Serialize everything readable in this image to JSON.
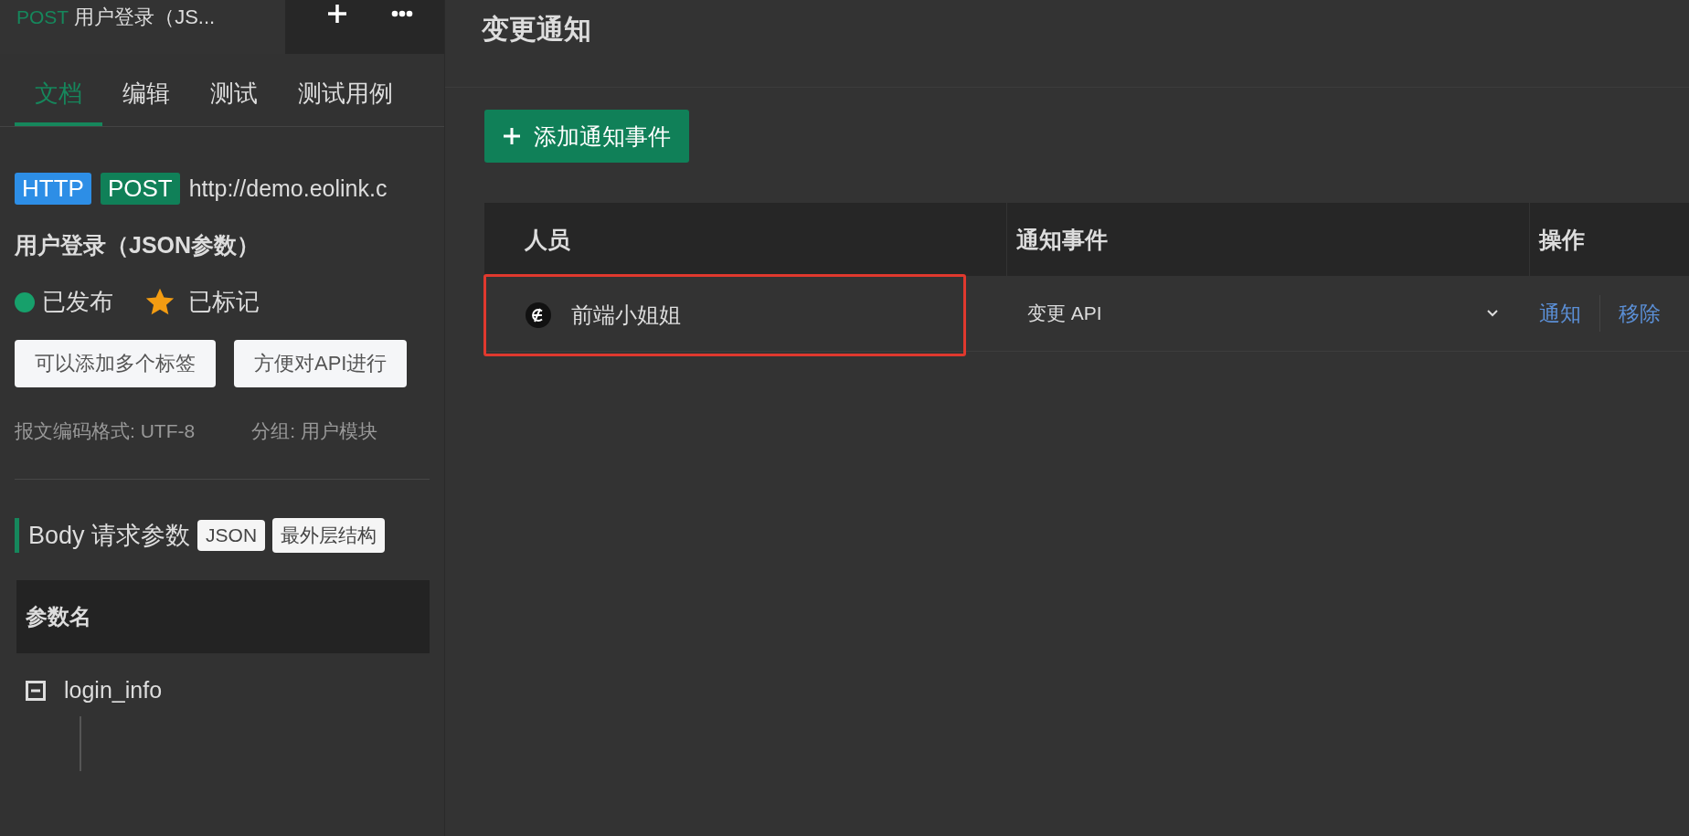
{
  "editor_tab": {
    "method": "POST",
    "title": "用户登录（JS..."
  },
  "doc_tabs": [
    {
      "label": "文档",
      "selected": true
    },
    {
      "label": "编辑",
      "selected": false
    },
    {
      "label": "测试",
      "selected": false
    },
    {
      "label": "测试用例",
      "selected": false
    }
  ],
  "api": {
    "protocol": "HTTP",
    "method": "POST",
    "url": "http://demo.eolink.c",
    "name": "用户登录（JSON参数）",
    "status": {
      "label": "已发布",
      "color": "#17a06b"
    },
    "starred": true,
    "star_label": "已标记",
    "tags": [
      "可以添加多个标签",
      "方便对API进行"
    ],
    "meta": [
      "报文编码格式: UTF-8",
      "分组: 用户模块"
    ]
  },
  "body": {
    "title": "Body 请求参数",
    "format": "JSON",
    "note": "最外层结构",
    "columns": [
      "参数名"
    ],
    "rows": [
      {
        "name": "login_info",
        "expanded": true
      }
    ]
  },
  "panel": {
    "title": "变更通知",
    "add_button": "添加通知事件",
    "columns": [
      "人员",
      "通知事件",
      "操作"
    ],
    "rows": [
      {
        "member": "前端小姐姐",
        "event": "变更 API",
        "actions": [
          "通知",
          "移除"
        ],
        "highlighted": true
      }
    ]
  }
}
